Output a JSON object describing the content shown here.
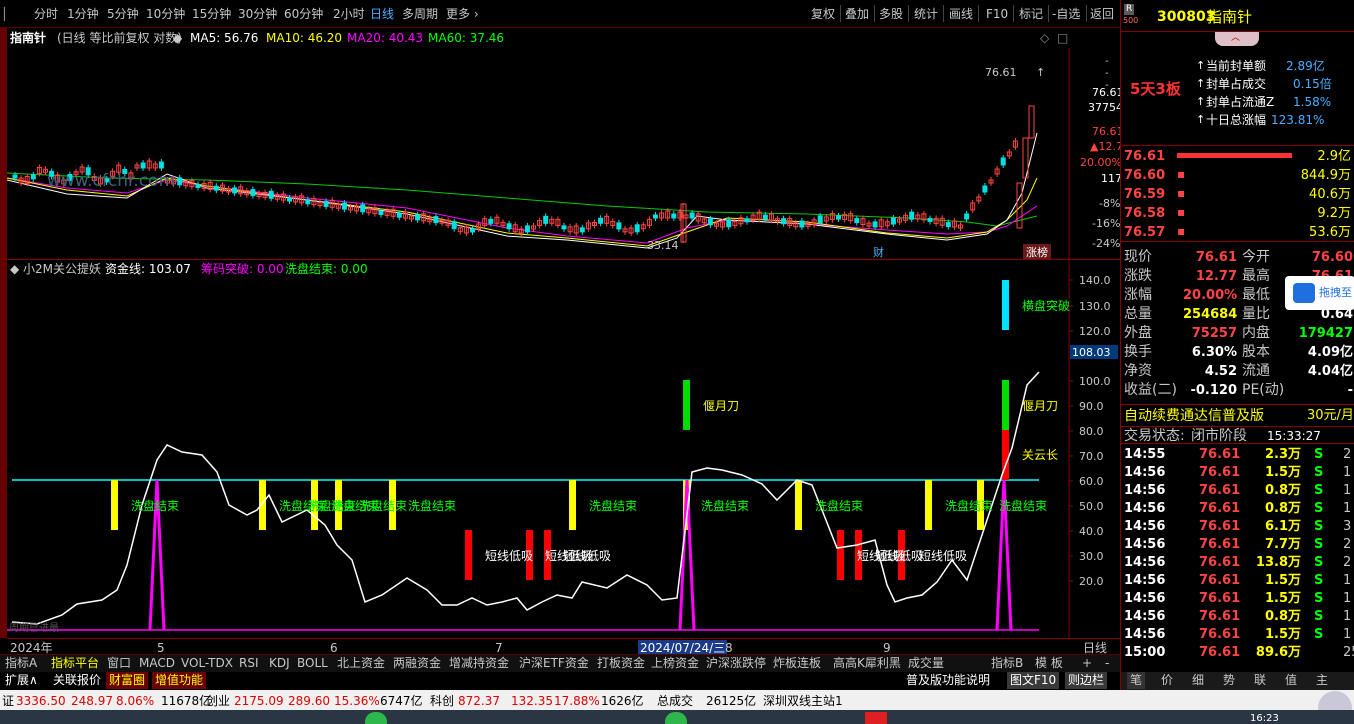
{
  "top_menu": {
    "periods": [
      "分时",
      "1分钟",
      "5分钟",
      "10分钟",
      "15分钟",
      "30分钟",
      "60分钟",
      "2小时",
      "日线",
      "多周期",
      "更多 ›"
    ],
    "active_period": "日线",
    "right_buttons": [
      "复权",
      "叠加",
      "多股",
      "统计",
      "画线",
      "F10",
      "标记",
      "-自选",
      "返回"
    ]
  },
  "stock_header": {
    "badge_top": "R",
    "badge_bottom": "500",
    "code": "300803",
    "name": "指南针"
  },
  "main_chart": {
    "title": "指南针",
    "subtitle": "(日线 等比前复权 对数)",
    "ma": [
      {
        "label": "MA5: 56.76",
        "color": "#ffffff"
      },
      {
        "label": "MA10: 46.20",
        "color": "#ffff00"
      },
      {
        "label": "MA20: 40.43",
        "color": "#ff00ff"
      },
      {
        "label": "MA60: 37.46",
        "color": "#00ff00"
      }
    ],
    "watermark": "www.cfchr.com",
    "high_label": "76.61",
    "low_label": "33.14",
    "fin_marker": "财",
    "zhangbang": "涨榜",
    "axis_labels": [
      "76.61",
      "37754",
      "76.61",
      "12.77",
      "20.00%",
      "117",
      "-8%",
      "-16%",
      "-24%"
    ]
  },
  "indicator": {
    "name": "小2M关公提妖",
    "line_label": "资金线: 103.07",
    "chip_label": "筹码突破: 0.00",
    "wash_label": "洗盘结束: 0.00",
    "axis_ticks": [
      "140.0",
      "130.0",
      "120.0",
      "100.0",
      "90.0",
      "80.0",
      "70.0",
      "60.0",
      "50.0",
      "40.0",
      "30.0",
      "20.0"
    ],
    "current_value": "108.03",
    "annotations": {
      "wash": "洗盘结束",
      "short": "短线低吸",
      "yanyue": "偃月刀",
      "henpan": "横盘突破",
      "guanyun": "关云长"
    }
  },
  "x_axis": {
    "labels": [
      "2024年",
      "5",
      "6",
      "7",
      "2024/07/24/三",
      "8",
      "9"
    ],
    "right_label": "日线",
    "bottom_left": "周期已进最"
  },
  "right_panel": {
    "seal": [
      {
        "label": "当前封单额",
        "value": "2.89亿"
      },
      {
        "label": "封单占成交",
        "value": "0.15倍"
      },
      {
        "label": "封单占流通Z",
        "value": "1.58%"
      },
      {
        "label": "十日总涨幅",
        "value": "123.81%"
      }
    ],
    "board_tag": "5天3板",
    "order_book": [
      {
        "price": "76.61",
        "vol": "2.9亿"
      },
      {
        "price": "76.60",
        "vol": "844.9万"
      },
      {
        "price": "76.59",
        "vol": "40.6万"
      },
      {
        "price": "76.58",
        "vol": "9.2万"
      },
      {
        "price": "76.57",
        "vol": "53.6万"
      }
    ],
    "quote": [
      {
        "l1": "现价",
        "v1": "76.61",
        "l2": "今开",
        "v2": "76.60"
      },
      {
        "l1": "涨跌",
        "v1": "12.77",
        "l2": "最高",
        "v2": "76.61"
      },
      {
        "l1": "涨幅",
        "v1": "20.00%",
        "l2": "最低",
        "v2": ""
      },
      {
        "l1": "总量",
        "v1": "254684",
        "l2": "量比",
        "v2": "0.64"
      },
      {
        "l1": "外盘",
        "v1": "75257",
        "l2": "内盘",
        "v2": "179427"
      },
      {
        "l1": "换手",
        "v1": "6.30%",
        "l2": "股本",
        "v2": "4.09亿"
      },
      {
        "l1": "净资",
        "v1": "4.52",
        "l2": "流通",
        "v2": "4.04亿"
      },
      {
        "l1": "收益(二)",
        "v1": "-0.120",
        "l2": "PE(动)",
        "v2": "-"
      }
    ],
    "popup_label": "拖拽至",
    "sector": "自动续费通达信普及版",
    "sector_price": "30元/月",
    "trade_status_label": "交易状态:",
    "trade_status": "闭市阶段",
    "trade_time": "15:33:27",
    "ticks": [
      {
        "t": "14:55",
        "p": "76.61",
        "v": "2.3万",
        "s": "S",
        "n": "2"
      },
      {
        "t": "14:56",
        "p": "76.61",
        "v": "1.5万",
        "s": "S",
        "n": "1"
      },
      {
        "t": "14:56",
        "p": "76.61",
        "v": "0.8万",
        "s": "S",
        "n": "1"
      },
      {
        "t": "14:56",
        "p": "76.61",
        "v": "0.8万",
        "s": "S",
        "n": "1"
      },
      {
        "t": "14:56",
        "p": "76.61",
        "v": "6.1万",
        "s": "S",
        "n": "3"
      },
      {
        "t": "14:56",
        "p": "76.61",
        "v": "7.7万",
        "s": "S",
        "n": "2"
      },
      {
        "t": "14:56",
        "p": "76.61",
        "v": "13.8万",
        "s": "S",
        "n": "2"
      },
      {
        "t": "14:56",
        "p": "76.61",
        "v": "1.5万",
        "s": "S",
        "n": "1"
      },
      {
        "t": "14:56",
        "p": "76.61",
        "v": "1.5万",
        "s": "S",
        "n": "1"
      },
      {
        "t": "14:56",
        "p": "76.61",
        "v": "0.8万",
        "s": "S",
        "n": "1"
      },
      {
        "t": "14:56",
        "p": "76.61",
        "v": "1.5万",
        "s": "S",
        "n": "1"
      },
      {
        "t": "15:00",
        "p": "76.61",
        "v": "89.6万",
        "s": "",
        "n": "25"
      }
    ],
    "bottom_tabs": [
      "笔",
      "价",
      "细",
      "势",
      "联",
      "值",
      "主"
    ]
  },
  "bottom_tabs": [
    "指标A",
    "指标平台",
    "窗口",
    "MACD",
    "VOL-TDX",
    "RSI",
    "KDJ",
    "BOLL",
    "北上资金",
    "两融资金",
    "增减持资金",
    "沪深ETF资金",
    "打板资金",
    "上榜资金",
    "沪深涨跌停",
    "炸板连板",
    "高高K犀利黑",
    "成交量"
  ],
  "bottom_tabs_right": [
    "指标B",
    "模 板",
    "+",
    "-"
  ],
  "bottom_tabs2": [
    "扩展∧",
    "关联报价",
    "财富圈",
    "增值功能"
  ],
  "bottom_tabs2_right": [
    "普及版功能说明",
    "图文F10",
    "则边栏"
  ],
  "status_bar": [
    {
      "label": "证",
      "value": "3336.50",
      "chg": "248.97",
      "pct": "8.06%",
      "amt": "11678亿"
    },
    {
      "label": "创业",
      "value": "2175.09",
      "chg": "289.60",
      "pct": "15.36%",
      "amt": "6747亿"
    },
    {
      "label": "科创",
      "value": "872.37",
      "chg": "132.35",
      "pct": "17.88%",
      "amt": "1626亿"
    }
  ],
  "status_extra": {
    "label": "总成交",
    "value": "26125亿",
    "station": "深圳双线主站1"
  },
  "taskbar_time": "16:23"
}
